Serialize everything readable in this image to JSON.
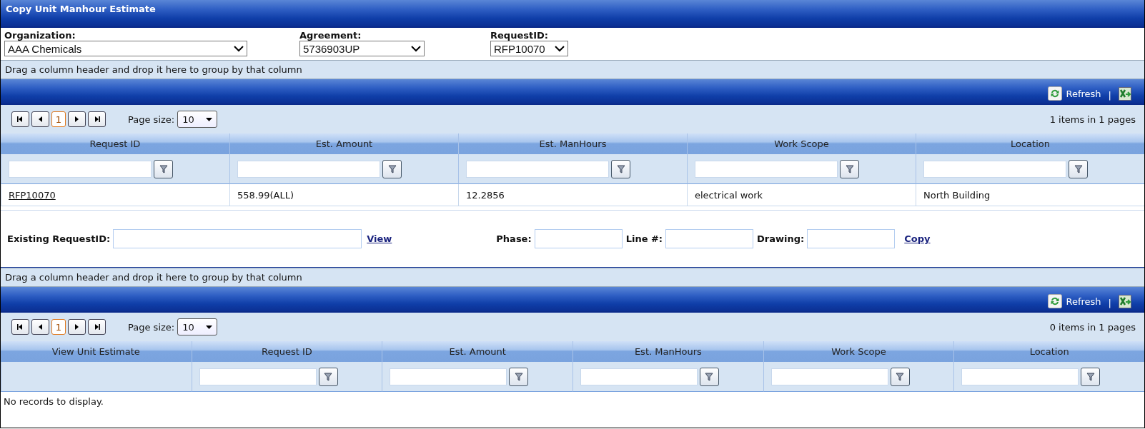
{
  "window": {
    "title": "Copy Unit Manhour Estimate"
  },
  "selectors": [
    {
      "label": "Organization:",
      "value": "AAA Chemicals"
    },
    {
      "label": "Agreement:",
      "value": "5736903UP"
    },
    {
      "label": "RequestID:",
      "value": "RFP10070"
    }
  ],
  "grids": [
    {
      "group_hint": "Drag a column header and drop it here to group by that column",
      "toolbar": {
        "refresh": "Refresh",
        "separator": "|"
      },
      "pager": {
        "pages": [
          {
            "label": "1",
            "selected": true
          }
        ],
        "page_size_label": "Page size:",
        "page_size": "10",
        "info": "1 items in 1 pages"
      },
      "columns": [
        {
          "title": "Request ID",
          "filterable": true
        },
        {
          "title": "Est. Amount",
          "filterable": true
        },
        {
          "title": "Est. ManHours",
          "filterable": true
        },
        {
          "title": "Work Scope",
          "filterable": true
        },
        {
          "title": "Location",
          "filterable": true
        }
      ],
      "rows": [
        {
          "cells": [
            {
              "text": "RFP10070",
              "kind": "link"
            },
            {
              "text": "558.99(ALL)",
              "kind": "text"
            },
            {
              "text": "12.2856",
              "kind": "text"
            },
            {
              "text": "electrical work",
              "kind": "text"
            },
            {
              "text": "North Building",
              "kind": "text"
            }
          ]
        }
      ]
    },
    {
      "group_hint": "Drag a column header and drop it here to group by that column",
      "toolbar": {
        "refresh": "Refresh",
        "separator": "|"
      },
      "pager": {
        "pages": [
          {
            "label": "1",
            "selected": true
          }
        ],
        "page_size_label": "Page size:",
        "page_size": "10",
        "info": "0 items in 1 pages"
      },
      "columns": [
        {
          "title": "View Unit Estimate",
          "filterable": false
        },
        {
          "title": "Request ID",
          "filterable": true
        },
        {
          "title": "Est. Amount",
          "filterable": true
        },
        {
          "title": "Est. ManHours",
          "filterable": true
        },
        {
          "title": "Work Scope",
          "filterable": true
        },
        {
          "title": "Location",
          "filterable": true
        }
      ],
      "empty_message": "No records to display."
    }
  ],
  "copy_form": {
    "existing_label": "Existing RequestID:",
    "view_link": "View",
    "fields": [
      {
        "label": "Phase:"
      },
      {
        "label": "Line #:"
      },
      {
        "label": "Drawing:"
      }
    ],
    "copy_link": "Copy"
  }
}
